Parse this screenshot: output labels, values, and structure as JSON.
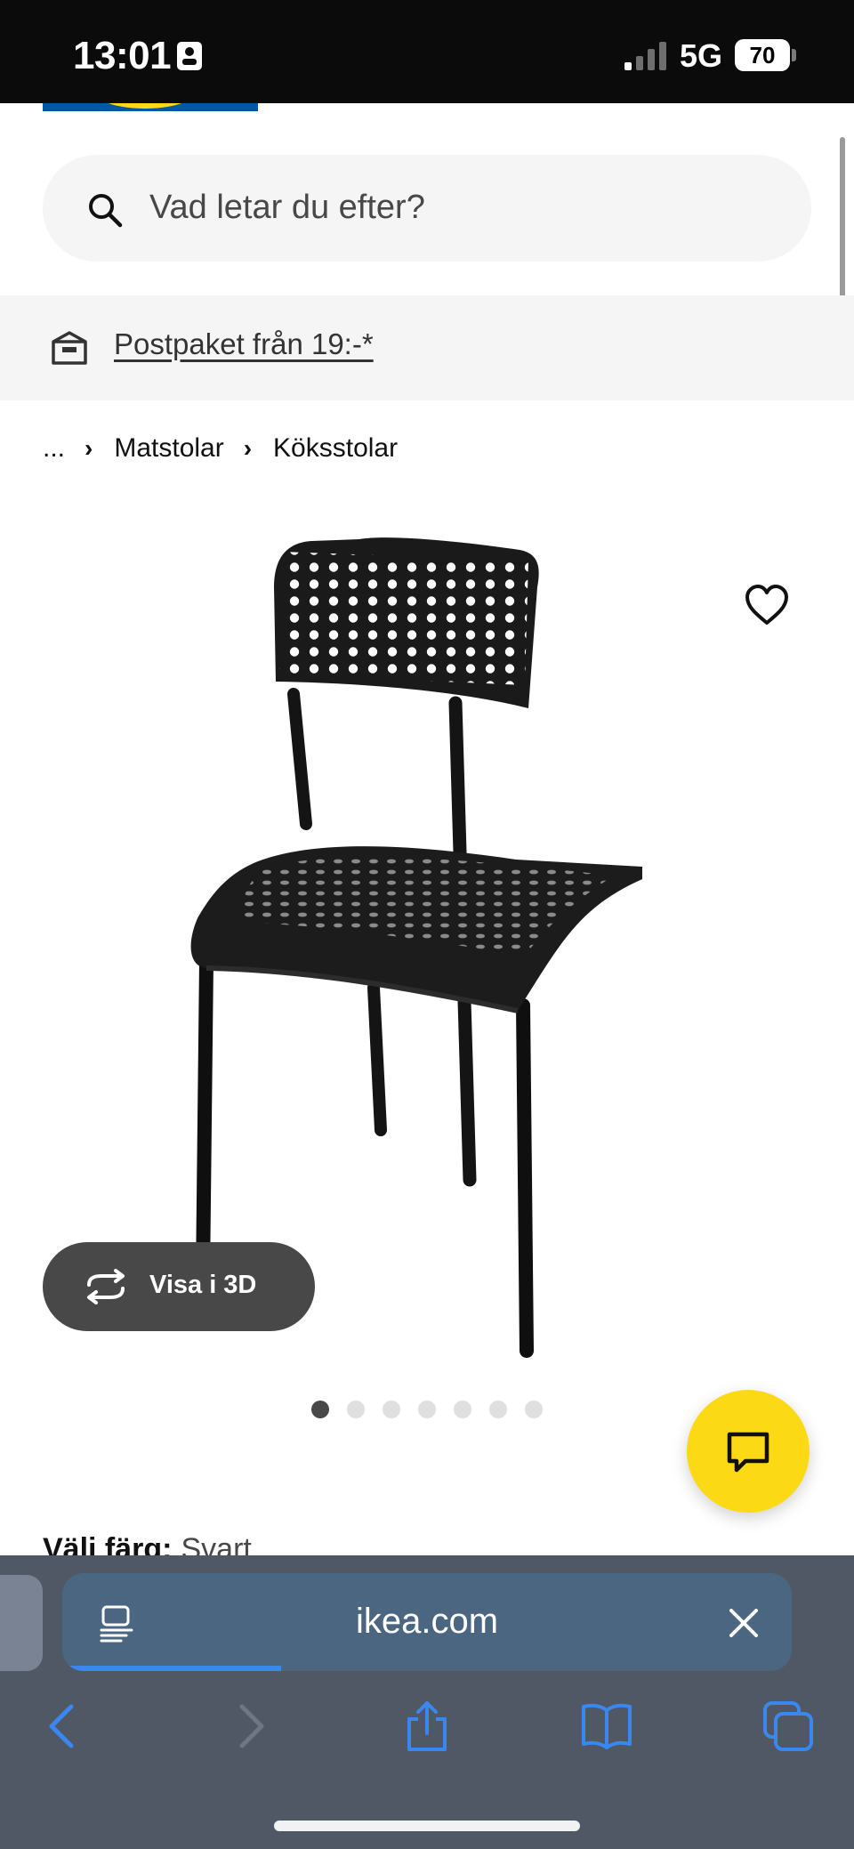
{
  "status_bar": {
    "time": "13:01",
    "network": "5G",
    "battery": "70"
  },
  "search": {
    "placeholder": "Vad letar du efter?"
  },
  "shipping_banner": {
    "text": "Postpaket från 19:-*"
  },
  "breadcrumb": {
    "items": [
      "...",
      "Matstolar",
      "Köksstolar"
    ]
  },
  "product": {
    "view_3d_label": "Visa i 3D",
    "carousel": {
      "total": 7,
      "active_index": 0
    },
    "color_label": "Välj färg:",
    "color_value": "Svart"
  },
  "browser": {
    "url": "ikea.com",
    "load_progress": 0.3
  },
  "icons": {
    "status_id": "person-card-icon",
    "signal": "signal-icon",
    "search": "search-icon",
    "shipping": "package-icon",
    "favorite": "heart-icon",
    "view_3d": "rotate-icon",
    "chat": "chat-icon",
    "reader": "reader-icon",
    "close": "close-icon",
    "back": "chevron-left-icon",
    "forward": "chevron-right-icon",
    "share": "share-icon",
    "bookmarks": "book-icon",
    "tabs": "tabs-icon"
  },
  "colors": {
    "brand_blue": "#0058a3",
    "brand_yellow": "#ffda1a",
    "chat_yellow": "#fbd914",
    "safari_accent": "#3b87f0"
  }
}
